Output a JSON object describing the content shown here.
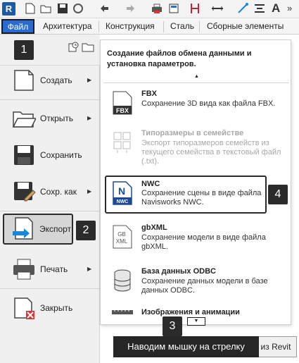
{
  "app": {
    "logo_letter": "R"
  },
  "quick_access_icons": [
    "open-folder-icon",
    "save-icon",
    "sync-icon",
    "undo-icon",
    "redo-icon",
    "print-icon",
    "measure-icon",
    "dimension-icon",
    "tag-icon",
    "text-icon"
  ],
  "tabs": [
    {
      "label": "Файл"
    },
    {
      "label": "Архитектура"
    },
    {
      "label": "Конструкция"
    },
    {
      "label": "Сталь"
    },
    {
      "label": "Сборные элементы"
    }
  ],
  "menu": [
    {
      "label": "Создать",
      "has_submenu": true,
      "icon": "new-file-icon"
    },
    {
      "label": "Открыть",
      "has_submenu": true,
      "icon": "open-folder-icon"
    },
    {
      "label": "Сохранить",
      "has_submenu": false,
      "icon": "save-icon"
    },
    {
      "label": "Сохр. как",
      "has_submenu": true,
      "icon": "save-as-icon"
    },
    {
      "label": "Экспорт",
      "has_submenu": false,
      "icon": "export-icon"
    },
    {
      "label": "Печать",
      "has_submenu": true,
      "icon": "print-icon"
    },
    {
      "label": "Закрыть",
      "has_submenu": false,
      "icon": "close-file-icon"
    }
  ],
  "popup": {
    "title": "Создание файлов обмена данными и установка параметров.",
    "items": [
      {
        "title": "FBX",
        "desc": "Сохранение 3D вида как файла FBX.",
        "icon_text": "FBX",
        "enabled": true
      },
      {
        "title": "Типоразмеры в семействе",
        "desc": "Экспорт типоразмеров семейств из текущего семейства в текстовый файл (.txt).",
        "icon_text": "",
        "enabled": false
      },
      {
        "title": "NWC",
        "desc": "Сохранение сцены в виде файла Navisworks NWC.",
        "icon_text": "NWC",
        "enabled": true
      },
      {
        "title": "gbXML",
        "desc": "Сохранение модели в виде файла gbXML.",
        "icon_text": "GB XML",
        "enabled": true
      },
      {
        "title": "База данных ODBC",
        "desc": "Сохранение данных модели в базе данных ODBC.",
        "icon_text": "",
        "enabled": true
      },
      {
        "title": "Изображения и анимации",
        "desc": "",
        "icon_text": "",
        "enabled": true
      }
    ]
  },
  "badges": [
    "1",
    "2",
    "3",
    "4"
  ],
  "tooltip": "Наводим мышку на стрелку",
  "bottom_button": "из Revit",
  "colors": {
    "file_tab": "#2a6bd1",
    "badge": "#2b2b2b",
    "accent_arrow": "#1a86d8"
  }
}
